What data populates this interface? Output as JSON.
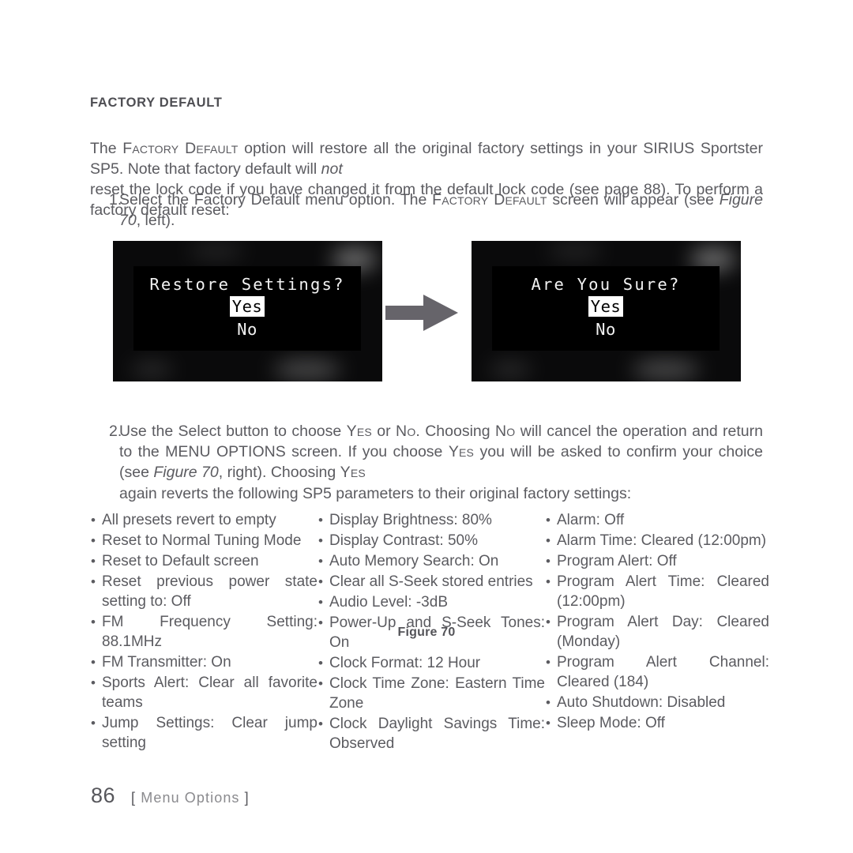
{
  "heading": "FACTORY DEFAULT",
  "intro": {
    "part1": "The ",
    "smallcaps1": "Factory Default",
    "part2": " option will restore all the original factory settings in your SIRIUS Sportster SP5. Note that factory default will ",
    "italic1": "not",
    "part3": " reset the lock code if you have changed it from the default lock code (see page 88). To perform a factory default reset:"
  },
  "steps": [
    {
      "num": "1.",
      "part1": "Select the Factory Default menu option. The ",
      "smallcaps1": "Factory Default",
      "part2": " screen will appear (see ",
      "italic1": "Figure 70",
      "part3": ", left)."
    },
    {
      "num": "2.",
      "part1": "Use the Select button to choose ",
      "smallcaps1": "Yes",
      "part2": " or ",
      "smallcaps2": "No",
      "part3": ". Choosing ",
      "smallcaps3": "No",
      "part4": " will cancel the operation and return to the MENU OPTIONS screen. If you choose ",
      "smallcaps4": "Yes",
      "part5": " you will be asked to confirm your choice (see ",
      "italic1": "Figure 70",
      "part6": ", right). Choosing ",
      "smallcaps5": "Yes",
      "part7": " again reverts the following SP5 parameters to their original factory settings:"
    }
  ],
  "figure": {
    "caption": "Figure 70",
    "arrow_color": "#66646a",
    "screens": [
      {
        "name": "restore-settings-screen",
        "title": "Restore Settings?",
        "option_selected": "Yes",
        "option_other": "No"
      },
      {
        "name": "are-you-sure-screen",
        "title": "Are You Sure?",
        "option_selected": "Yes",
        "option_other": "No"
      }
    ]
  },
  "columns": [
    {
      "items": [
        "All presets revert to empty",
        "Reset to Normal Tuning Mode",
        "Reset to Default screen",
        "Reset previous power state setting to: Off",
        "FM Frequency Setting: 88.1MHz",
        "FM Transmitter: On",
        "Sports Alert: Clear all favorite teams",
        "Jump Settings: Clear jump setting"
      ]
    },
    {
      "items": [
        "Display Brightness: 80%",
        "Display Contrast: 50%",
        "Auto Memory Search: On",
        "Clear all S-Seek stored entries",
        "Audio Level: -3dB",
        "Power-Up and S-Seek Tones: On",
        "Clock Format: 12 Hour",
        "Clock Time Zone: Eastern Time Zone",
        "Clock Daylight Savings Time: Observed"
      ]
    },
    {
      "items": [
        "Alarm: Off",
        "Alarm Time: Cleared (12:00pm)",
        "Program Alert: Off",
        "Program Alert Time: Cleared (12:00pm)",
        "Program Alert Day: Cleared (Monday)",
        "Program Alert Channel: Cleared (184)",
        "Auto Shutdown: Disabled",
        "Sleep Mode: Off"
      ]
    }
  ],
  "footer": {
    "page_number": "86",
    "bracket_open": "[",
    "section": "Menu Options",
    "bracket_close": "]"
  }
}
